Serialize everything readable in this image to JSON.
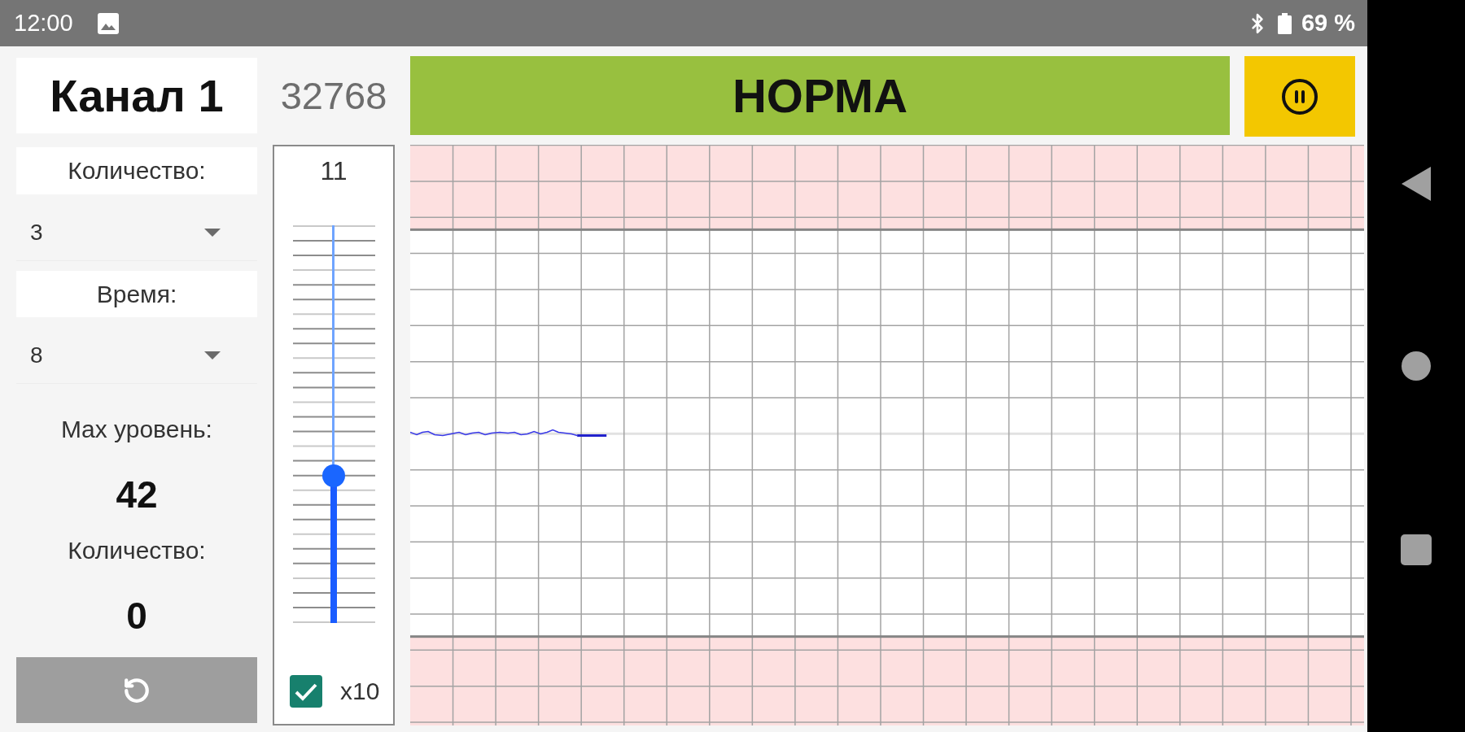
{
  "status_bar": {
    "time": "12:00",
    "battery": "69 %"
  },
  "channel": {
    "title": "Канал 1"
  },
  "settings": [
    {
      "label": "Количество:",
      "value": "3"
    },
    {
      "label": "Время:",
      "value": "8"
    }
  ],
  "stats": [
    {
      "label": "Max уровень:",
      "value": "42"
    },
    {
      "label": "Количество:",
      "value": "0"
    }
  ],
  "counter": "32768",
  "status": "НОРМА",
  "gain": {
    "reading": "11",
    "level": 0.37,
    "multiplier": {
      "label": "x10",
      "checked": true
    }
  }
}
